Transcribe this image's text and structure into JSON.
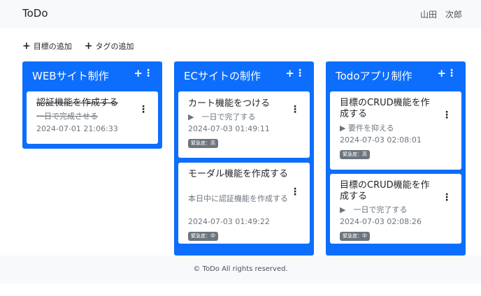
{
  "app": {
    "brand": "ToDo",
    "user": "山田　次郎"
  },
  "actions": {
    "add_goal": "目標の追加",
    "add_tag": "タグの追加"
  },
  "columns": [
    {
      "title": "WEBサイト制作",
      "cards": [
        {
          "title": "認証機能を作成する",
          "sub": "一日で完成させる",
          "date": "2024-07-01 21:06:33",
          "badge": "",
          "done": true
        }
      ]
    },
    {
      "title": "ECサイトの制作",
      "cards": [
        {
          "title": "カート機能をつける",
          "sub": "▶　一日で完了する",
          "date": "2024-07-03 01:49:11",
          "badge": "緊急度：高"
        },
        {
          "title": "モーダル機能を作成する",
          "sub": "本日中に認証機能を作成する",
          "date": "2024-07-03 01:49:22",
          "badge": "緊急度：中"
        }
      ]
    },
    {
      "title": "Todoアプリ制作",
      "cards": [
        {
          "title": "目標のCRUD機能を作成する",
          "sub": "▶ 要件を抑える",
          "date": "2024-07-03 02:08:01",
          "badge": "緊急度：高"
        },
        {
          "title": "目標のCRUD機能を作成する",
          "sub": "▶　一日で完了する",
          "date": "2024-07-03 02:08:26",
          "badge": "緊急度：中"
        }
      ]
    }
  ],
  "footer": {
    "text": "© ToDo All rights reserved."
  }
}
